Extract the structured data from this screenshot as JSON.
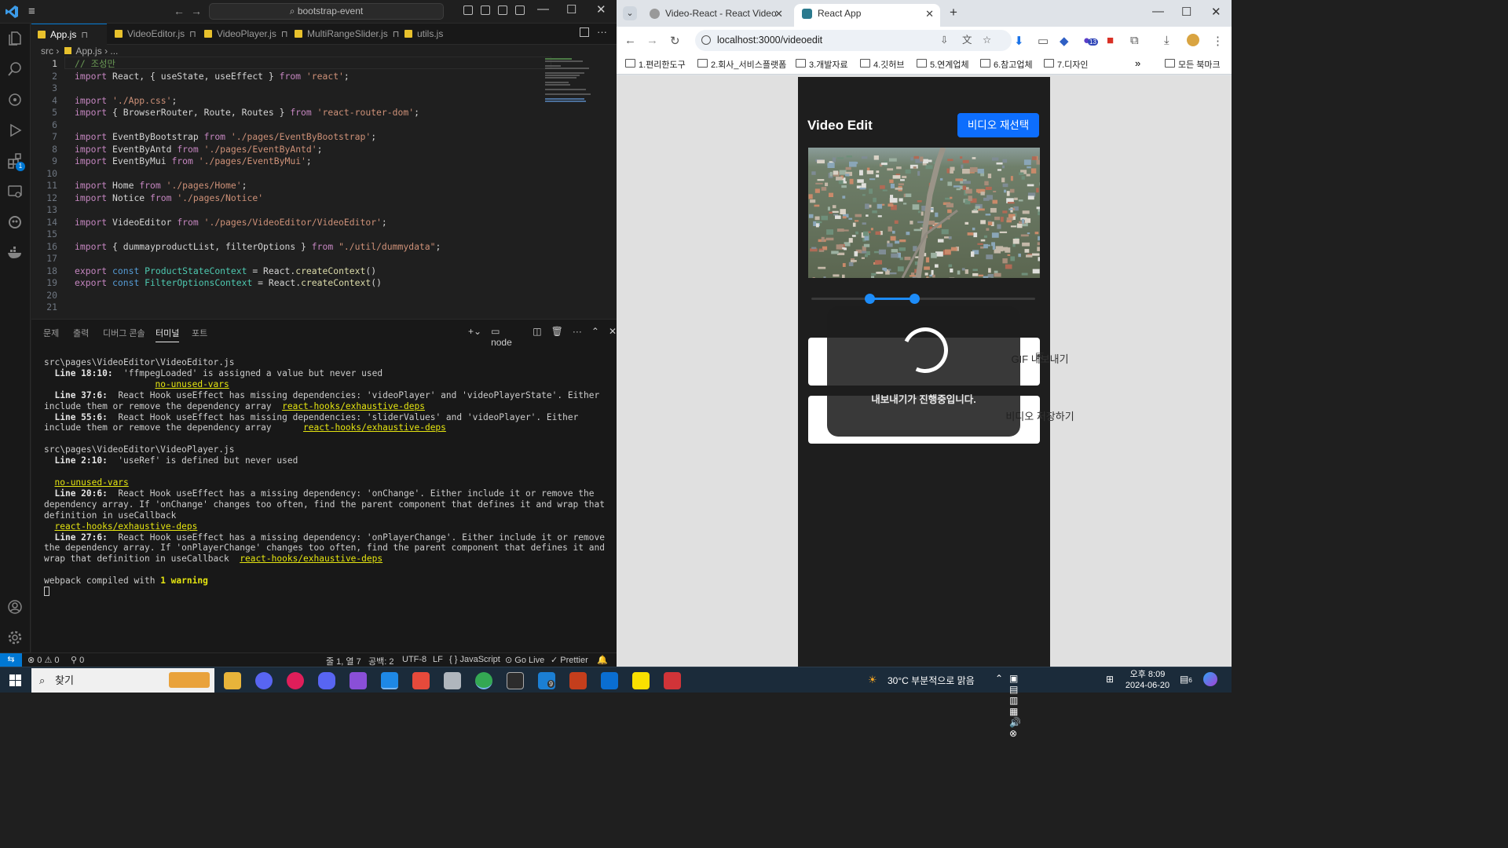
{
  "vscode": {
    "menu_glyph": "≡",
    "search_text": "bootstrap-event",
    "tabs": [
      {
        "label": "App.js",
        "pin": "⊓"
      },
      {
        "label": "VideoEditor.js",
        "pin": "⊓"
      },
      {
        "label": "VideoPlayer.js",
        "pin": "⊓"
      },
      {
        "label": "MultiRangeSlider.js",
        "pin": "⊓"
      },
      {
        "label": "utils.js"
      }
    ],
    "breadcrumb": {
      "folder": "src",
      "sep": "›",
      "file": "App.js",
      "tail": "›  ..."
    },
    "code_lines": [
      {
        "n": "1",
        "text": "// 조성만"
      },
      {
        "n": "2",
        "text": "import React, { useState, useEffect } from 'react';"
      },
      {
        "n": "3",
        "text": ""
      },
      {
        "n": "4",
        "text": "import './App.css';"
      },
      {
        "n": "5",
        "text": "import { BrowserRouter, Route, Routes } from 'react-router-dom';"
      },
      {
        "n": "6",
        "text": ""
      },
      {
        "n": "7",
        "text": "import EventByBootstrap from './pages/EventByBootstrap';"
      },
      {
        "n": "8",
        "text": "import EventByAntd from './pages/EventByAntd';"
      },
      {
        "n": "9",
        "text": "import EventByMui from './pages/EventByMui';"
      },
      {
        "n": "10",
        "text": ""
      },
      {
        "n": "11",
        "text": "import Home from './pages/Home';"
      },
      {
        "n": "12",
        "text": "import Notice from './pages/Notice'"
      },
      {
        "n": "13",
        "text": ""
      },
      {
        "n": "14",
        "text": "import VideoEditor from './pages/VideoEditor/VideoEditor';"
      },
      {
        "n": "15",
        "text": ""
      },
      {
        "n": "16",
        "text": "import { dummayproductList, filterOptions } from \"./util/dummydata\";"
      },
      {
        "n": "17",
        "text": ""
      },
      {
        "n": "18",
        "text": "export const ProductStateContext = React.createContext()"
      },
      {
        "n": "19",
        "text": "export const FilterOptionsContext = React.createContext()"
      },
      {
        "n": "20",
        "text": ""
      },
      {
        "n": "21",
        "text": ""
      }
    ],
    "panel": {
      "tabs": [
        "문제",
        "출력",
        "디버그 콘솔",
        "터미널",
        "포트"
      ],
      "active_tab": "터미널",
      "shell_label": "node",
      "terminal": {
        "file1": "src\\pages\\VideoEditor\\VideoEditor.js",
        "l1_loc": "Line 18:10:",
        "l1_msg": "  'ffmpegLoaded' is assigned a value but never used",
        "l1_rule": "no-unused-vars",
        "l2_loc": "Line 37:6:",
        "l2_msg": "  React Hook useEffect has missing dependencies: 'videoPlayer' and 'videoPlayerState'. Either include them or remove the dependency array",
        "l2_rule": "react-hooks/exhaustive-deps",
        "l3_loc": "Line 55:6:",
        "l3_msg": "  React Hook useEffect has missing dependencies: 'sliderValues' and 'videoPlayer'. Either include them or remove the dependency array",
        "l3_rule": "react-hooks/exhaustive-deps",
        "file2": "src\\pages\\VideoEditor\\VideoPlayer.js",
        "l4_loc": "Line 2:10:",
        "l4_msg": "  'useRef' is defined but never used",
        "l4_rule": "no-unused-vars",
        "l5_loc": "Line 20:6:",
        "l5_msg": "  React Hook useEffect has a missing dependency: 'onChange'. Either include it or remove the dependency array. If 'onChange' changes too often, find the parent component that defines it and wrap that definition in useCallback",
        "l5_rule": "react-hooks/exhaustive-deps",
        "l6_loc": "Line 27:6:",
        "l6_msg": "  React Hook useEffect has a missing dependency: 'onPlayerChange'. Either include it or remove the dependency array. If 'onPlayerChange' changes too often, find the parent component that defines it and wrap that definition in useCallback",
        "l6_rule": "react-hooks/exhaustive-deps",
        "compiled_pre": "webpack compiled with ",
        "compiled_warn": "1 warning"
      }
    },
    "status": {
      "errors": "⊗ 0 ⚠ 0",
      "ports": "⚲ 0",
      "position": "줄 1, 열 7",
      "spaces": "공백: 2",
      "encoding": "UTF-8",
      "eol": "LF",
      "language": "{ } JavaScript",
      "golive": "Go Live",
      "prettier": "✓ Prettier"
    },
    "activity_badge": "1"
  },
  "chrome": {
    "tabs": [
      {
        "label": "Video-React - React Video Co",
        "close": "✕"
      },
      {
        "label": "React App",
        "close": "✕"
      }
    ],
    "new_tab": "+",
    "url": "localhost:3000/videoedit",
    "extension_badge": "13",
    "bookmarks": [
      "1.편리한도구",
      "2.회사_서비스플랫폼",
      "3.개발자료",
      "4.깃허브",
      "5.연계업체",
      "6.참고업체",
      "7.디자인"
    ],
    "bookmarks_more": "»",
    "all_bookmarks": "모든 북마크"
  },
  "app": {
    "title": "Video Edit",
    "reselect_button": "비디오 재선택",
    "gif_button": "GIF 내보내기",
    "save_button": "비디오 저장하기",
    "overlay_text": "내보내기가 진행중입니다.",
    "slider": {
      "min": 0.26,
      "max": 0.46
    }
  },
  "taskbar": {
    "search_placeholder": "찾기",
    "weather": "30°C  부분적으로 맑음",
    "time": "오후 8:09",
    "date": "2024-06-20",
    "notif_badge": "6",
    "vscode_badge": "9"
  }
}
